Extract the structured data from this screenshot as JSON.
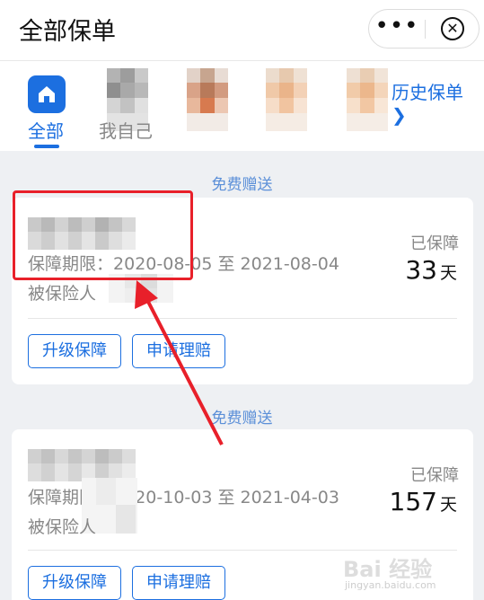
{
  "header": {
    "title": "全部保单",
    "more_glyph": "•••",
    "close_glyph": "✕"
  },
  "tabs": {
    "all_label": "全部",
    "items": [
      {
        "label": "我自己"
      },
      {
        "label": ""
      },
      {
        "label": ""
      },
      {
        "label": ""
      }
    ],
    "history_label": "历史保单",
    "history_chevron": "❯",
    "active_color": "#1c6fe0"
  },
  "policies": [
    {
      "badge": "免费赠送",
      "period_prefix": "保障期限：",
      "period_end": "2020-08-05 至 2021-08-04",
      "insured_label": "被保险人",
      "status_label": "已保障",
      "days": "33",
      "days_unit": "天",
      "upgrade_label": "升级保障",
      "claim_label": "申请理赔"
    },
    {
      "badge": "免费赠送",
      "period_prefix": "保障期限：",
      "period_end": "2020-10-03 至 2021-04-03",
      "insured_label": "被保险人",
      "status_label": "已保障",
      "days": "157",
      "days_unit": "天",
      "upgrade_label": "升级保障",
      "claim_label": "申请理赔"
    }
  ],
  "watermark": {
    "main": "Bai 经验",
    "sub": "jingyan.baidu.com"
  },
  "annotation_color": "#e8202a"
}
